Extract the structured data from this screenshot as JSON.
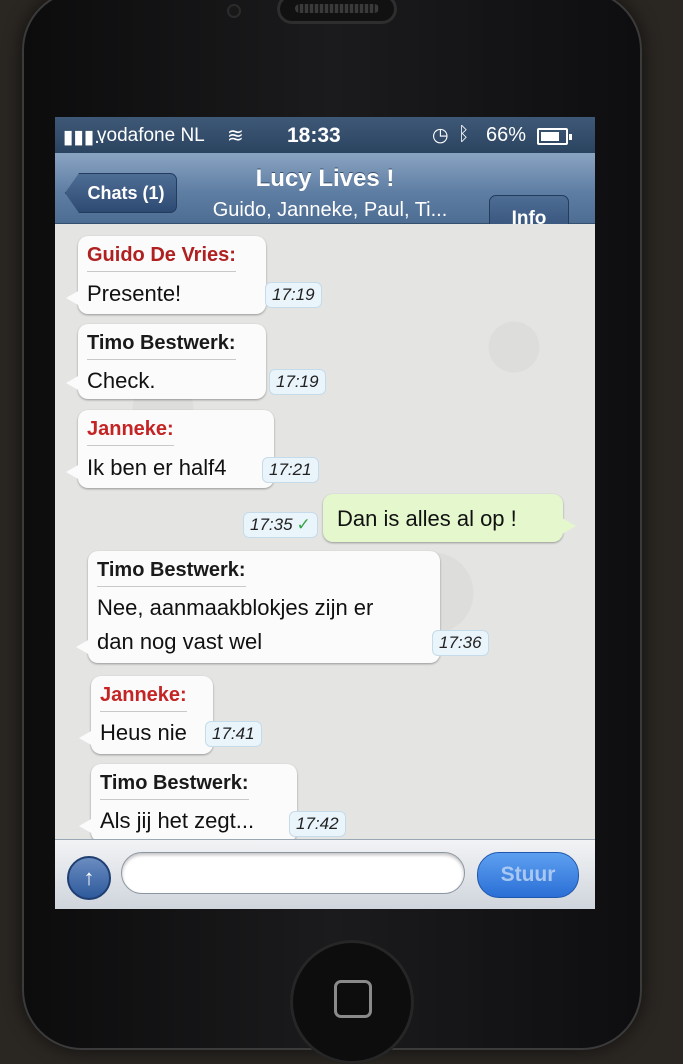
{
  "status_bar": {
    "signal_icon": "signal-bars-icon",
    "carrier": "vodafone NL",
    "wifi_icon": "wifi-icon",
    "time": "18:33",
    "alarm_icon": "alarm-clock-icon",
    "bluetooth_icon": "bluetooth-icon",
    "battery": "66%",
    "battery_level": 0.66
  },
  "nav": {
    "back_label": "Chats (1)",
    "title": "Lucy Lives !",
    "subtitle": "Guido, Janneke, Paul, Ti...",
    "info_label": "Info"
  },
  "messages": [
    {
      "sender": "Guido De Vries:",
      "text": "Presente!",
      "time": "17:19",
      "sender_color": "#b02020"
    },
    {
      "sender": "Timo Bestwerk:",
      "text": "Check.",
      "time": "17:19",
      "sender_color": "#1a1a1a"
    },
    {
      "sender": "Janneke:",
      "text": "Ik ben er half4",
      "time": "17:21",
      "sender_color": "#c42424"
    },
    {
      "sender": "",
      "text": "Dan is alles al op !",
      "time": "17:35",
      "outgoing": true,
      "read_icon": "checkmark-icon"
    },
    {
      "sender": "Timo Bestwerk:",
      "text_lines": [
        "Nee, aanmaakblokjes zijn er",
        "dan nog vast wel"
      ],
      "time": "17:36",
      "sender_color": "#1a1a1a"
    },
    {
      "sender": "Janneke:",
      "text": "Heus nie",
      "time": "17:41",
      "sender_color": "#c42424"
    },
    {
      "sender": "Timo Bestwerk:",
      "text": "Als jij het zegt...",
      "time": "17:42",
      "sender_color": "#1a1a1a"
    }
  ],
  "input_bar": {
    "attach_icon": "arrow-up-icon",
    "placeholder": "",
    "send_label": "Stuur"
  },
  "colors": {
    "nav_blue": "#5f7ea3",
    "outgoing_bubble": "#e5f7cd",
    "send_button": "#2b6fd6"
  }
}
